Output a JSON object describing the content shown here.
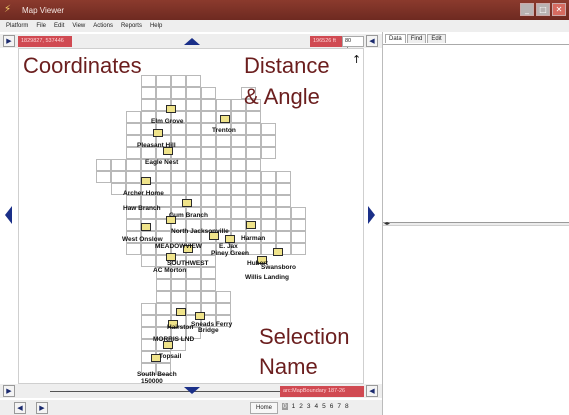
{
  "window": {
    "title": "Map Viewer",
    "controls": [
      "minimize-icon",
      "maximize-icon",
      "close-icon"
    ]
  },
  "menu": [
    "Platform",
    "File",
    "Edit",
    "View",
    "Actions",
    "Reports",
    "Help"
  ],
  "toolbar": {
    "coordinates_value": "1829827, 537446",
    "distance_value": "196526 ft",
    "angle_value": "80 deg."
  },
  "map": {
    "places": [
      "Elm Grove",
      "Trenton",
      "Pleasant Hill",
      "Eagle Nest",
      "Archer Home",
      "Haw Branch",
      "Gum Branch",
      "North Jacksonville",
      "West Onslow",
      "Harman",
      "MEADOWVIEW",
      "E. Jax",
      "Piney Green",
      "SOUTHWEST",
      "AC Morton",
      "Hubert",
      "Swansboro",
      "Willis Landing",
      "Hairston",
      "Sneads Ferry",
      "Bridge",
      "MORRIS LND",
      "Topsail",
      "South Beach"
    ],
    "scale_label": "150000"
  },
  "overlays": {
    "coordinates": "Coordinates",
    "distance": "Distance",
    "angle": "& Angle",
    "selection": "Selection",
    "name": "Name"
  },
  "bottom": {
    "selection_name": "arc:MapBoundary 187-26",
    "home_tab": "Home",
    "pages": [
      "0",
      "1",
      "2",
      "3",
      "4",
      "5",
      "6",
      "7",
      "8"
    ]
  },
  "right_panel": {
    "tabs": [
      "Data",
      "Find",
      "Edit"
    ],
    "active_tab": "Data"
  },
  "colors": {
    "titlebar": "#7a3126",
    "accent_red": "#d04a52",
    "nav_blue": "#1a2f88",
    "overlay_text": "#6b1e1e",
    "quad_fill": "#efe38a"
  }
}
